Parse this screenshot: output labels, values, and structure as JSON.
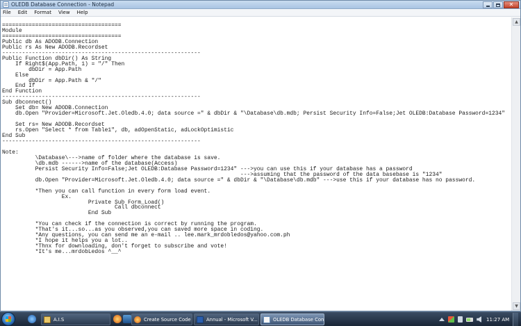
{
  "window": {
    "title": "OLEDB Database Connection - Notepad",
    "controls": {
      "minimize": "–",
      "maximize": "□",
      "close": "✕"
    }
  },
  "menu": [
    "File",
    "Edit",
    "Format",
    "View",
    "Help"
  ],
  "document": {
    "text": "====================================\nModule\n====================================\nPublic db As ADODB.Connection\nPublic rs As New ADODB.Recordset\n------------------------------------------------------------\nPublic Function dbDir() As String\n    If Right$(App.Path, 1) = \"/\" Then\n        dbDir = App.Path\n    Else\n        dbDir = App.Path & \"/\"\n    End If\nEnd Function\n------------------------------------------------------------\nSub dbconnect()\n    Set db= New ADODB.Connection\n    db.Open \"Provider=Microsoft.Jet.Oledb.4.0; data source =\" & dbDir & \"\\Database\\db.mdb; Persist Security Info=False;Jet OLEDB:Database Password=1234\"\n\n    Set rs= New ADODB.Recordset\n    rs.Open \"Select * from Table1\", db, adOpenStatic, adLockOptimistic\nEnd Sub\n------------------------------------------------------------\n\nNote:\n          \\Database\\--->name of folder where the database is save.\n          \\db.mdb ------>name of the database(Access)\n          Persist Security Info=False;Jet OLEDB:Database Password=1234\" --->you can use this if your database has a password\n                                                                        --->assuming that the password of the data basebase is \"1234\"\n          db.Open \"Provider=Microsoft.Jet.Oledb.4.0; data source =\" & dbDir & \"\\Database\\db.mdb\" --->use this if your database has no password.\n\n          *Then you can call function in every form load event.\n                  Ex.\n                          Private Sub Form_Load()\n                                  Call dbconnect\n                          End Sub\n\n          *You can check if the connection is correct by running the program.\n          *That's it...so...as you observed,you can saved more space in coding.\n          *Any questions, you can send me an e-mail .. lee.mark_mrdobledos@yahoo.com.ph\n          *I hope it helps you a lot..\n          *Thnx for downloading, don't forget to subscribe and vote!\n          *It's me...mrdobLedos ^__^"
  },
  "taskbar": {
    "buttons": [
      {
        "label": "A.I.S"
      },
      {
        "label": "Create Source Code |..."
      },
      {
        "label": "Annual - Microsoft V..."
      },
      {
        "label": "OLEDB Database Con..."
      }
    ],
    "clock": "11:27 AM"
  }
}
